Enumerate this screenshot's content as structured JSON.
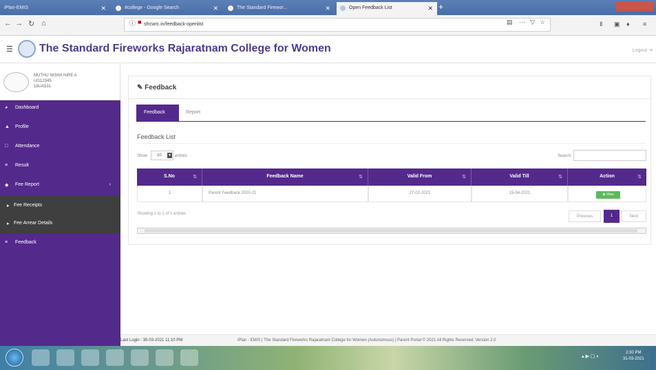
{
  "browser": {
    "tabs": [
      {
        "label": "iPlan-EMIS"
      },
      {
        "label": "#college - Google Search"
      },
      {
        "label": "The Standard Firewor..."
      },
      {
        "label": "Open Feedback List"
      }
    ],
    "url": "sfrcwrc.in/feedback-openlist",
    "url_domain": "sfrcw.in"
  },
  "app": {
    "college_name": "The Standard Fireworks Rajaratnam College for Women",
    "logout": "Logout"
  },
  "profile": {
    "name_line1": "MUTHU NISHA NIRE A",
    "name_line2": "UG12345",
    "name_line3": "18UA531"
  },
  "sidebar": {
    "items": [
      {
        "label": "Dashboard",
        "icon": "dashboard-icon"
      },
      {
        "label": "Profile",
        "icon": "user-icon"
      },
      {
        "label": "Attendance",
        "icon": "calendar-icon"
      },
      {
        "label": "Result",
        "icon": "list-icon"
      },
      {
        "label": "Fee Report",
        "icon": "tag-icon"
      }
    ],
    "submenu": [
      {
        "label": "Fee Receipts"
      },
      {
        "label": "Fee Arrear Details"
      }
    ],
    "feedback_label": "Feedback"
  },
  "main": {
    "section_title": "Feedback",
    "tabs": [
      {
        "label": "Feedback"
      },
      {
        "label": "Report"
      }
    ],
    "list_title": "Feedback List",
    "show_label": "Show",
    "entries_value": "10",
    "entries_label": "entries",
    "search_label": "Search:",
    "search_value": "",
    "table": {
      "headers": [
        "S.No",
        "Feedback Name",
        "Valid From",
        "Valid Till",
        "Action"
      ],
      "rows": [
        {
          "sno": "1",
          "name": "Parent Feedback 2020-21",
          "from": "27-02-2021",
          "till": "15-04-2021",
          "action": "View"
        }
      ]
    },
    "showing_text": "Showing 1 to 1 of 1 entries",
    "pagination": {
      "previous": "Previous",
      "page": "1",
      "next": "Next"
    }
  },
  "footer": {
    "last_login": "Last Login : 30-03-2021 11:10 PM",
    "copyright": "iPlan - EMIS | The Standard Fireworks Rajaratnam College for Women (Autonomous) | Parent Portal © 2021 All Rights Reserved. Version 2.0"
  },
  "taskbar": {
    "time": "2:30 PM",
    "date": "31-03-2021"
  }
}
